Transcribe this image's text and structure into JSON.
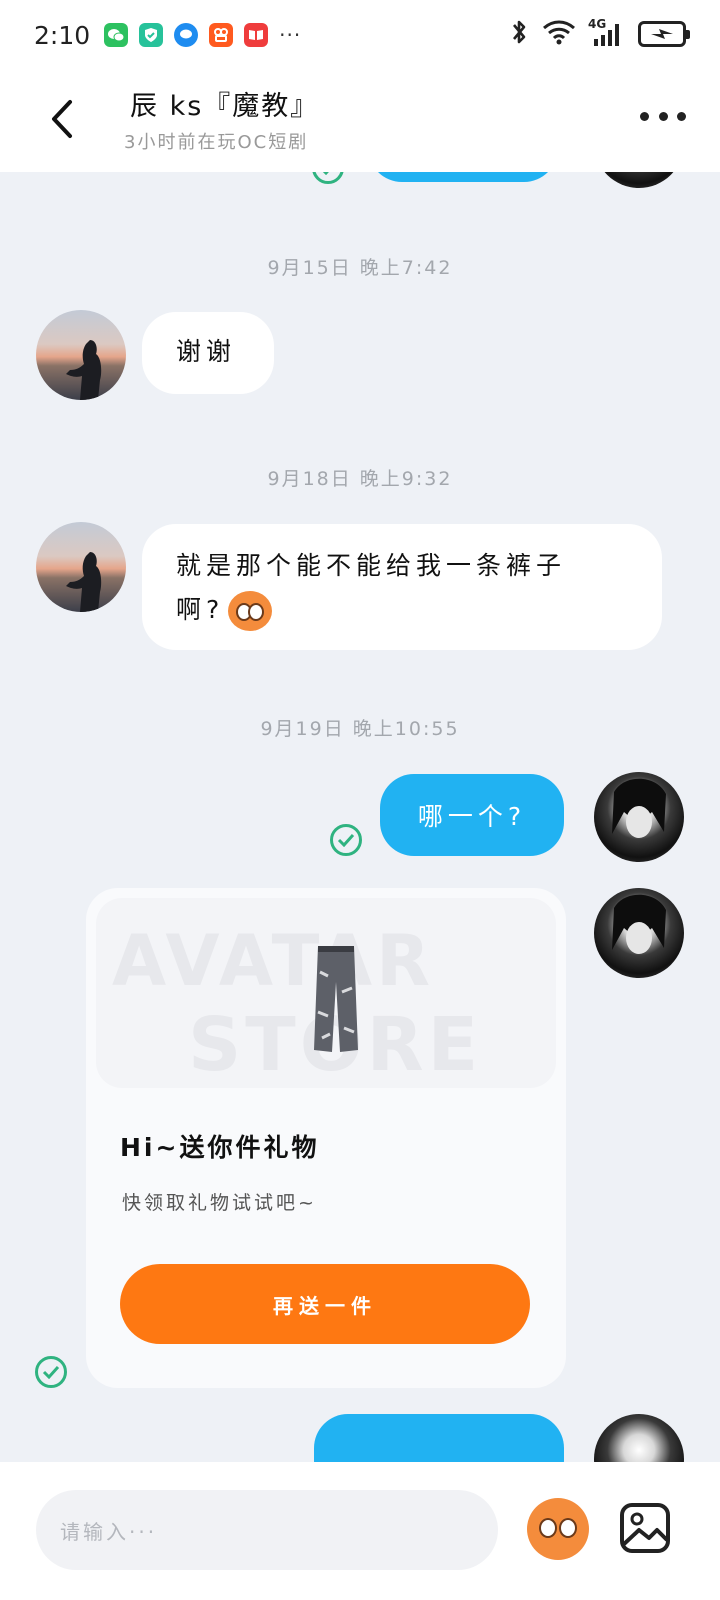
{
  "status_bar": {
    "time": "2:10",
    "notification_icons": [
      "wechat-icon",
      "shield-app-icon",
      "message-app-icon",
      "kuaishou-icon",
      "book-app-icon"
    ],
    "more_dots": "···",
    "network": "4G",
    "battery": "charging"
  },
  "header": {
    "contact_name": "辰 ks『魔教』",
    "contact_status": "3小时前在玩OC短剧"
  },
  "chat": {
    "messages": [
      {
        "time": "9月15日 晚上7:42",
        "side": "left",
        "text": "谢谢"
      },
      {
        "time": "9月18日 晚上9:32",
        "side": "left",
        "text_line1": "就是那个能不能给我一条裤子",
        "text_line2": "啊?"
      },
      {
        "time": "9月19日 晚上10:55",
        "side": "right",
        "text": "哪一个?",
        "status": "read"
      }
    ],
    "gift_card": {
      "watermark_line1": "AVATAR",
      "watermark_line2": "STORE",
      "title": "Hi~送你件礼物",
      "subtitle": "快领取礼物试试吧~",
      "button_label": "再送一件"
    }
  },
  "input_bar": {
    "placeholder": "请输入···"
  },
  "colors": {
    "accent_blue": "#21b2f2",
    "accent_orange": "#fe7812",
    "read_check_green": "#2fb380",
    "background": "#eef1f6"
  }
}
